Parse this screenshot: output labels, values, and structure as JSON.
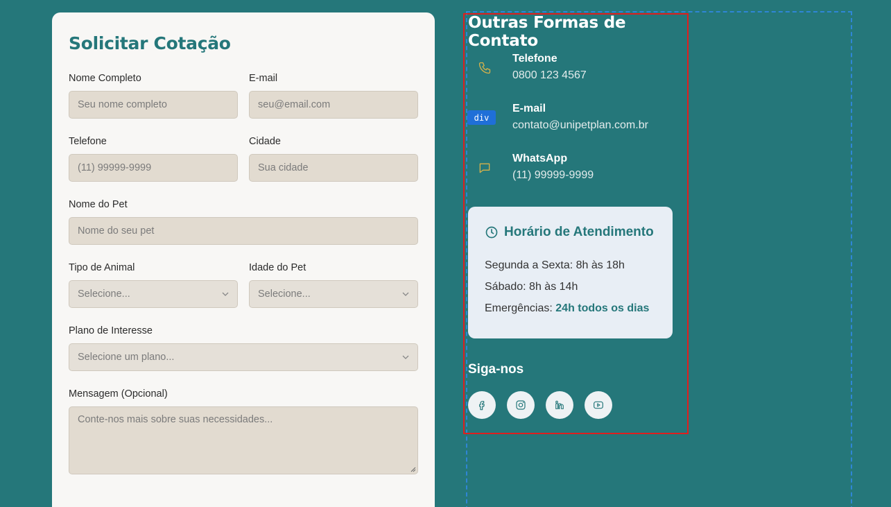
{
  "form": {
    "title": "Solicitar Cotação",
    "name_label": "Nome Completo",
    "name_placeholder": "Seu nome completo",
    "email_label": "E-mail",
    "email_placeholder": "seu@email.com",
    "phone_label": "Telefone",
    "phone_placeholder": "(11) 99999-9999",
    "city_label": "Cidade",
    "city_placeholder": "Sua cidade",
    "pet_name_label": "Nome do Pet",
    "pet_name_placeholder": "Nome do seu pet",
    "animal_type_label": "Tipo de Animal",
    "animal_type_value": "Selecione...",
    "pet_age_label": "Idade do Pet",
    "pet_age_value": "Selecione...",
    "plan_label": "Plano de Interesse",
    "plan_value": "Selecione um plano...",
    "message_label": "Mensagem (Opcional)",
    "message_placeholder": "Conte-nos mais sobre suas necessidades..."
  },
  "contact": {
    "title": "Outras Formas de Contato",
    "inspector_tag": "div",
    "items": [
      {
        "label": "Telefone",
        "value": "0800 123 4567",
        "icon": "phone-icon"
      },
      {
        "label": "E-mail",
        "value": "contato@unipetplan.com.br",
        "icon": "mail-icon"
      },
      {
        "label": "WhatsApp",
        "value": "(11) 99999-9999",
        "icon": "message-icon"
      }
    ]
  },
  "hours": {
    "title": "Horário de Atendimento",
    "weekdays": "Segunda a Sexta: 8h às 18h",
    "saturday": "Sábado: 8h às 14h",
    "emergency_prefix": "Emergências: ",
    "emergency_value": "24h todos os dias"
  },
  "social": {
    "title": "Siga-nos",
    "icons": [
      "facebook-icon",
      "instagram-icon",
      "linkedin-icon",
      "youtube-icon"
    ]
  },
  "colors": {
    "background": "#25777a",
    "accent": "#25777a",
    "icon_gold": "#d6b24a",
    "card": "#f8f7f5"
  }
}
